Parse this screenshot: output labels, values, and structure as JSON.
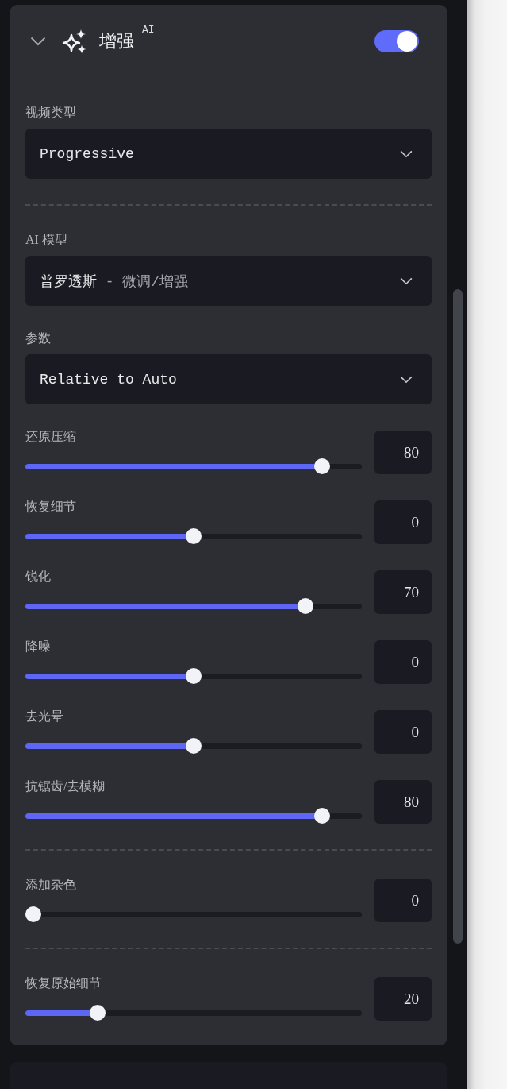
{
  "panel": {
    "title": "增强",
    "badge": "AI",
    "expanded": true,
    "enabled": true
  },
  "groups": [
    [
      {
        "kind": "select",
        "label": "视频类型",
        "value": "Progressive"
      }
    ],
    [
      {
        "kind": "select",
        "label": "AI 模型",
        "value": "普罗透斯",
        "note": "- 微调/增强"
      },
      {
        "kind": "select",
        "label": "参数",
        "value": "Relative to Auto"
      },
      {
        "kind": "slider",
        "label": "还原压缩",
        "value": "80",
        "level": 0.9
      },
      {
        "kind": "slider",
        "label": "恢复细节",
        "value": "0",
        "level": 0.5
      },
      {
        "kind": "slider",
        "label": "锐化",
        "value": "70",
        "level": 0.85
      },
      {
        "kind": "slider",
        "label": "降噪",
        "value": "0",
        "level": 0.5
      },
      {
        "kind": "slider",
        "label": "去光晕",
        "value": "0",
        "level": 0.5
      },
      {
        "kind": "slider",
        "label": "抗锯齿/去模糊",
        "value": "80",
        "level": 0.9
      }
    ],
    [
      {
        "kind": "slider",
        "label": "添加杂色",
        "value": "0",
        "level": 0
      }
    ],
    [
      {
        "kind": "slider",
        "label": "恢复原始细节",
        "value": "20",
        "level": 0.2
      }
    ]
  ]
}
